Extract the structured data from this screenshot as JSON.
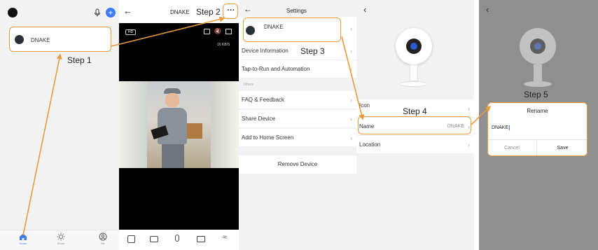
{
  "steps": {
    "s1": "Step 1",
    "s2": "Step 2",
    "s3": "Step 3",
    "s4": "Step 4",
    "s5": "Step 5"
  },
  "home": {
    "device_name": "DNAKE",
    "nav": [
      {
        "label": "Home"
      },
      {
        "label": "Smart"
      },
      {
        "label": "Me"
      }
    ]
  },
  "live": {
    "title": "DNAKE",
    "more_label": "···",
    "hd_badge": "HD",
    "speed": "16 KB/S"
  },
  "settings": {
    "title": "Settings",
    "device_name": "DNAKE",
    "items": {
      "device_info": "Device Information",
      "tap_to_run": "Tap-to-Run and Automation",
      "others_header": "Others",
      "faq": "FAQ & Feedback",
      "share": "Share Device",
      "add_home": "Add to Home Screen"
    },
    "remove": "Remove Device"
  },
  "device": {
    "rows": {
      "icon": "Icon",
      "name": "Name",
      "name_value": "DNAKE",
      "location": "Location"
    }
  },
  "rename": {
    "title": "Rename",
    "input_value": "DNAKE",
    "cancel": "Cancel",
    "save": "Save"
  },
  "colors": {
    "accent": "#e89a3c",
    "brand_blue": "#3d7bfd"
  }
}
